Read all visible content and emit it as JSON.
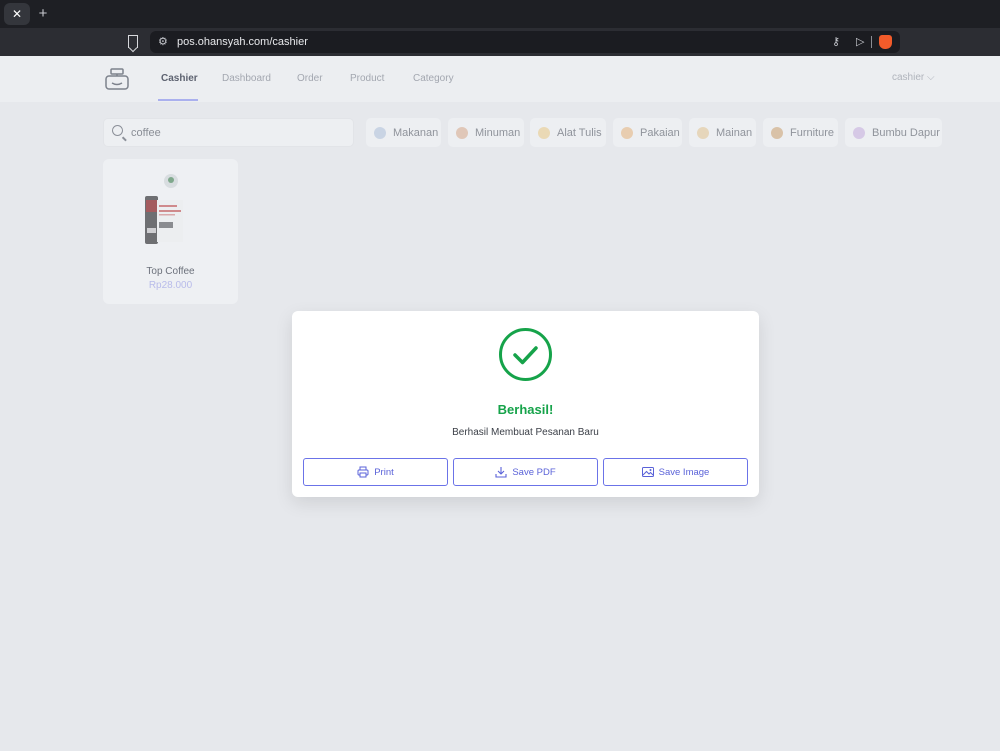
{
  "browser": {
    "tab_close_glyph": "✕",
    "new_tab_glyph": "+",
    "url": "pos.ohansyah.com/cashier"
  },
  "nav": {
    "links": [
      {
        "label": "Cashier",
        "active": true
      },
      {
        "label": "Dashboard"
      },
      {
        "label": "Order"
      },
      {
        "label": "Product"
      },
      {
        "label": "Category"
      }
    ],
    "user": "cashier"
  },
  "search": {
    "value": "coffee"
  },
  "categories": [
    {
      "label": "Makanan",
      "icon": "food-icon"
    },
    {
      "label": "Minuman",
      "icon": "drink-icon"
    },
    {
      "label": "Alat Tulis",
      "icon": "stationery-icon"
    },
    {
      "label": "Pakaian",
      "icon": "clothing-icon"
    },
    {
      "label": "Mainan",
      "icon": "toy-icon"
    },
    {
      "label": "Furniture",
      "icon": "furniture-icon"
    },
    {
      "label": "Bumbu Dapur",
      "icon": "spice-icon"
    }
  ],
  "products": [
    {
      "name": "Top Coffee",
      "price": "Rp28.000"
    }
  ],
  "modal": {
    "title": "Berhasil!",
    "message": "Berhasil Membuat Pesanan Baru",
    "buttons": {
      "print": "Print",
      "save_pdf": "Save PDF",
      "save_image": "Save Image"
    }
  },
  "colors": {
    "success": "#16a34a",
    "accent": "#5a62d8",
    "overlay_bg": "#e6e8ec"
  }
}
